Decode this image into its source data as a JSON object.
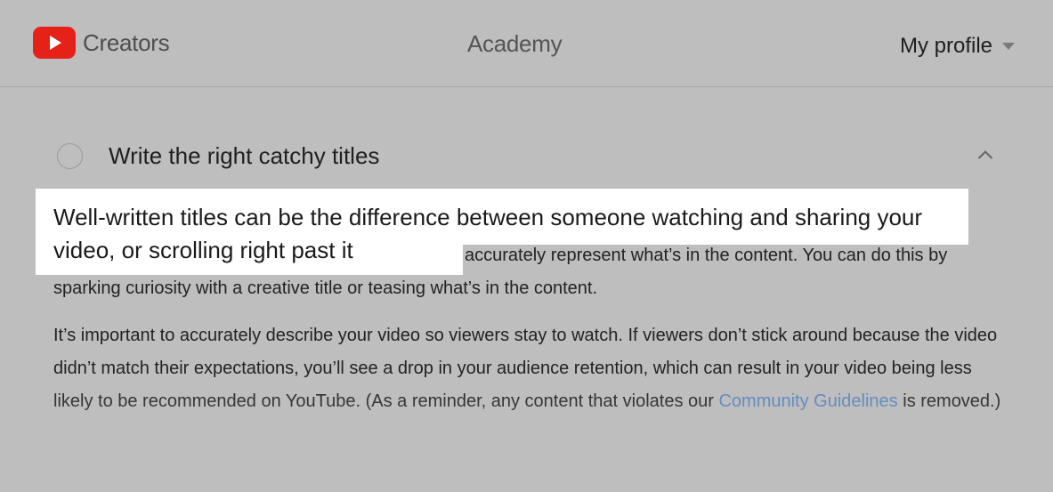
{
  "header": {
    "brand": "Creators",
    "nav_academy": "Academy",
    "profile_label": "My profile",
    "logo_icon": "youtube-play-icon",
    "brand_color": "#e62117"
  },
  "lesson": {
    "title": "Write the right catchy titles",
    "status_icon": "incomplete-circle-icon",
    "toggle_icon": "chevron-up-icon"
  },
  "callout": {
    "text": "Well-written titles can be the difference between someone watching and sharing your video, or scrolling right past it"
  },
  "content": {
    "p1_visible": "accurately represent what’s in the content. You can do this by sparking curiosity with a creative title or teasing what’s in the content.",
    "p2_part1": "It’s important to accurately describe your video so viewers stay to watch. If viewers don’t stick around because the video didn’t match their expectations, you’ll see a drop in your audience retention, which can result in your video being less likely to be recommended on YouTube. (As a reminder, any content that violates our ",
    "p2_link": "Community Guidelines",
    "p2_part2": " is removed.)"
  }
}
